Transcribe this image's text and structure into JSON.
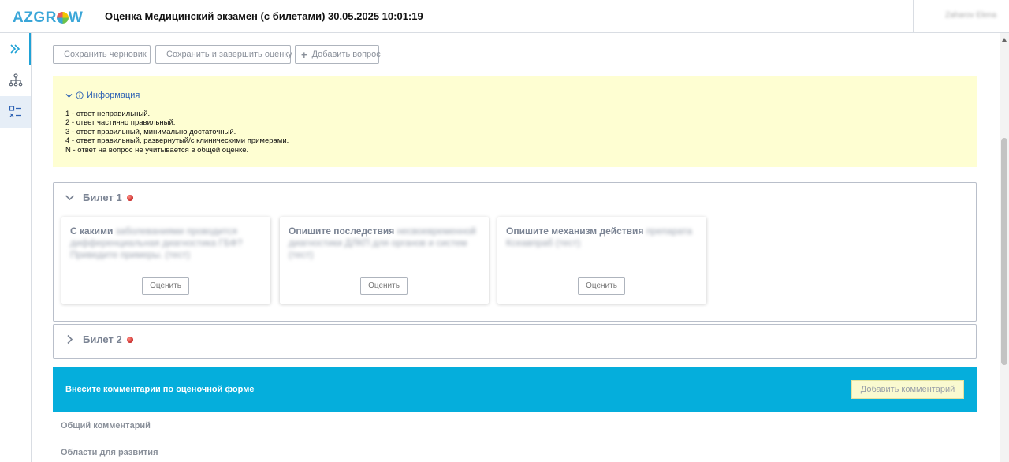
{
  "app": {
    "logo": "AZGROW",
    "title": "Оценка Медицинский экзамен (с билетами) 30.05.2025 10:01:19",
    "user_name": "Zaharov Elena"
  },
  "toolbar": {
    "save_draft": "Сохранить черновик",
    "save_finish": "Сохранить и завершить оценку",
    "add_question": "Добавить вопрос"
  },
  "info": {
    "header": "Информация",
    "lines": [
      "1 - ответ неправильный.",
      "2 - ответ частично правильный.",
      "3 - ответ правильный, минимально достаточный.",
      "4 - ответ правильный, развернутый/с клиническими примерами.",
      "N - ответ на вопрос не учитывается в общей оценке."
    ]
  },
  "tickets": [
    {
      "label": "Билет 1",
      "status_color": "#d32f2f",
      "expanded": true,
      "questions": [
        {
          "bold": "С какими",
          "rest": "заболеваниями проводится дифференциальная диагностика ГБФ? Приведите примеры. (тест)",
          "button": "Оценить"
        },
        {
          "bold": "Опишите последствия",
          "rest": "несвоевременной диагностики ДЛКП для органов и систем (тест)",
          "button": "Оценить"
        },
        {
          "bold": "Опишите механизм действия",
          "rest": "препарата Ксеавпраб (тест)",
          "button": "Оценить"
        }
      ]
    },
    {
      "label": "Билет 2",
      "status_color": "#d32f2f",
      "expanded": false
    }
  ],
  "comments": {
    "title": "Внесите комментарии по оценочной форме",
    "add_button": "Добавить комментарий",
    "general": "Общий комментарий",
    "development": "Области для развития"
  },
  "colors": {
    "accent": "#05aedc",
    "info_bg": "#fefed2",
    "link": "#2e62b4"
  }
}
